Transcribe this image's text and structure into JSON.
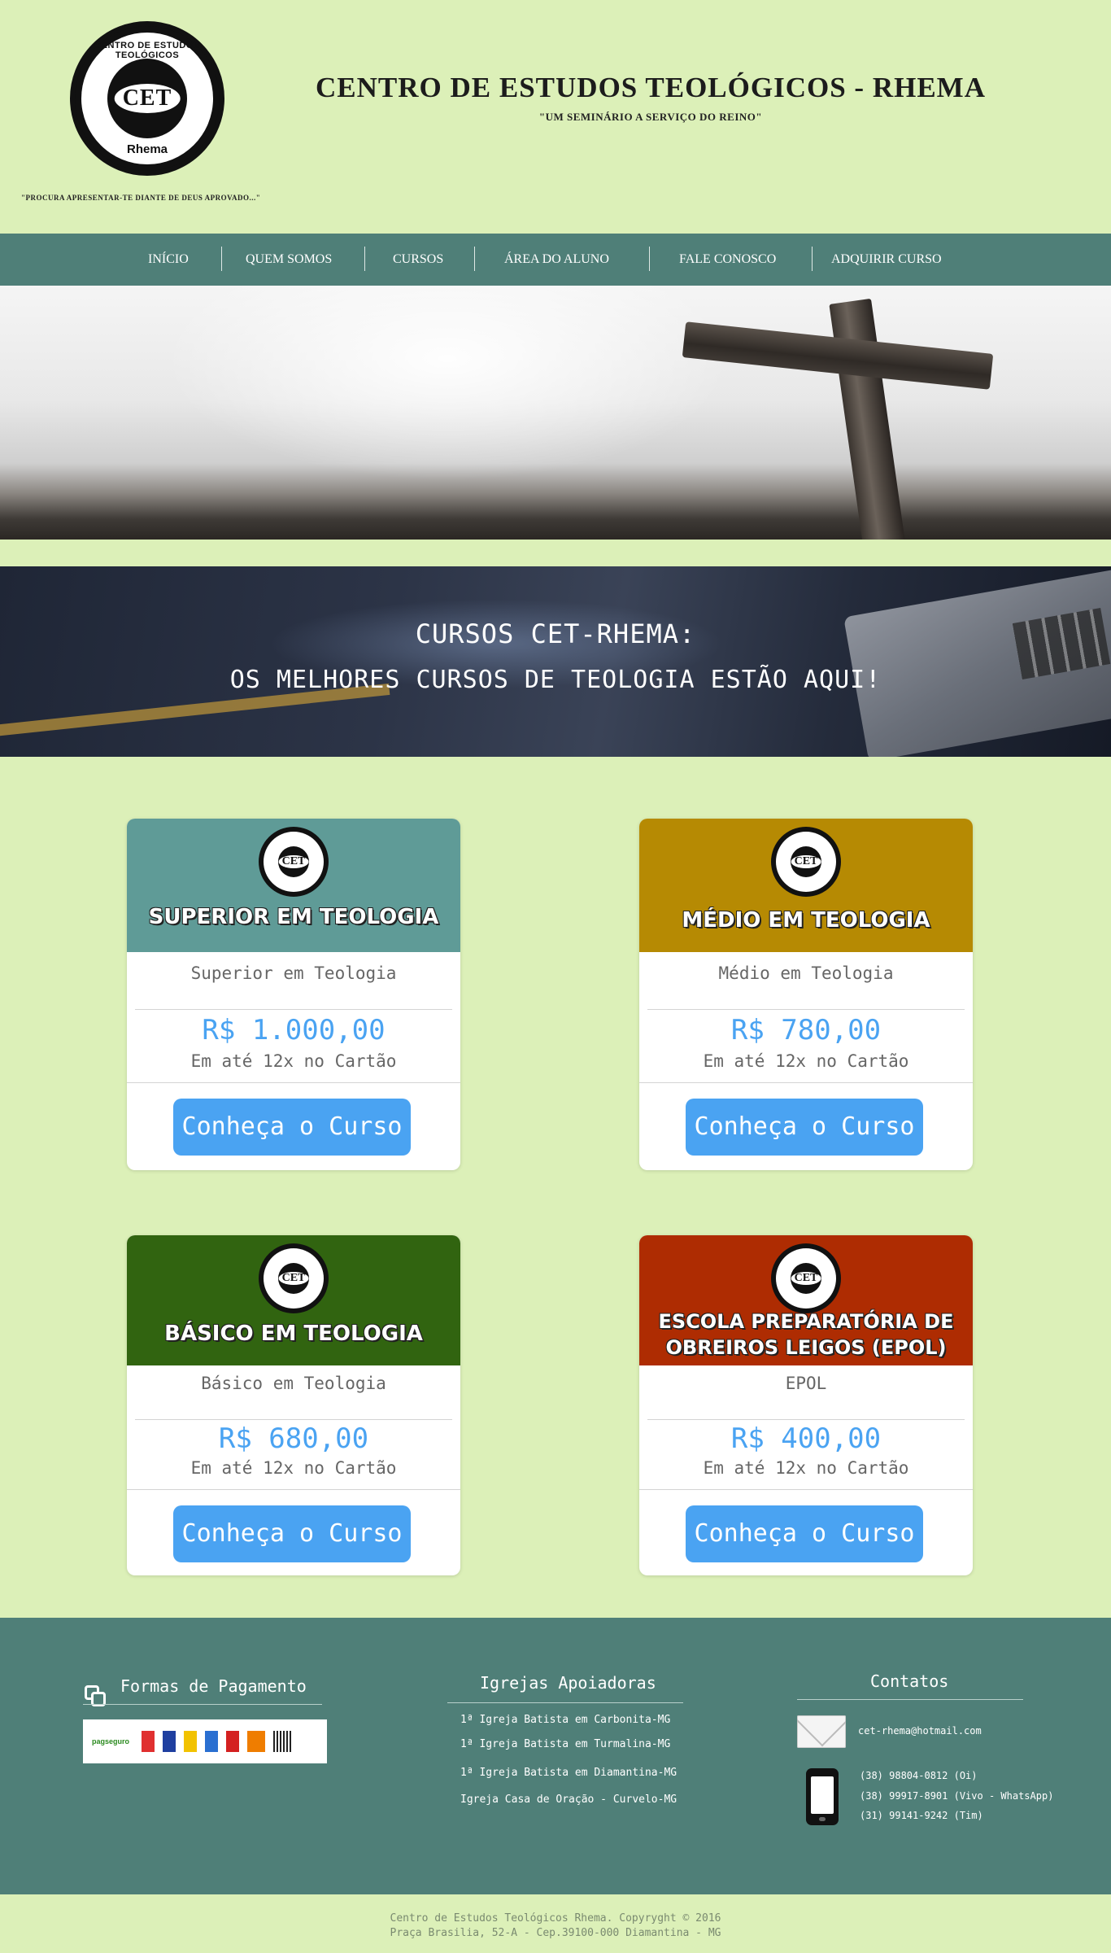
{
  "header": {
    "logo": {
      "ring_top": "CENTRO DE ESTUDOS TEOLÓGICOS",
      "ring_bottom": "Rhema",
      "monogram": "CET"
    },
    "title": "CENTRO DE ESTUDOS TEOLÓGICOS - RHEMA",
    "subtitle": "\"UM SEMINÁRIO A SERVIÇO DO REINO\"",
    "quote": "\"PROCURA APRESENTAR-TE DIANTE DE DEUS APROVADO...\""
  },
  "nav": {
    "items": [
      {
        "label": "INÍCIO"
      },
      {
        "label": "QUEM SOMOS"
      },
      {
        "label": "CURSOS"
      },
      {
        "label": "ÁREA DO ALUNO"
      },
      {
        "label": "FALE CONOSCO"
      },
      {
        "label": "ADQUIRIR CURSO"
      }
    ]
  },
  "banner": {
    "title": "CURSOS CET-RHEMA:",
    "subtitle": "OS MELHORES CURSOS DE TEOLOGIA ESTÃO AQUI!"
  },
  "courses": [
    {
      "head_lines": [
        "SUPERIOR EM TEOLOGIA"
      ],
      "name": "Superior em Teologia",
      "price": "R$ 1.000,00",
      "installments": "Em até 12x no Cartão",
      "button": "Conheça o Curso",
      "color": "#5f9b97"
    },
    {
      "head_lines": [
        "MÉDIO EM TEOLOGIA"
      ],
      "name": "Médio em Teologia",
      "price": "R$ 780,00",
      "installments": "Em até 12x no Cartão",
      "button": "Conheça o Curso",
      "color": "#b68a03"
    },
    {
      "head_lines": [
        "BÁSICO EM TEOLOGIA"
      ],
      "name": "Básico em Teologia",
      "price": "R$ 680,00",
      "installments": "Em até 12x no Cartão",
      "button": "Conheça o Curso",
      "color": "#316410"
    },
    {
      "head_lines": [
        "ESCOLA PREPARATÓRIA DE",
        "OBREIROS LEIGOS (EPOL)"
      ],
      "name": "EPOL",
      "price": "R$ 400,00",
      "installments": "Em até 12x no Cartão",
      "button": "Conheça o Curso",
      "color": "#ae2c02"
    }
  ],
  "footer": {
    "payment": {
      "title": "Formas de Pagamento",
      "logos": [
        "pagseguro",
        "visa",
        "mastercard",
        "banco do brasil",
        "bradesco",
        "hsbc",
        "itau",
        "boleto"
      ]
    },
    "churches": {
      "title": "Igrejas Apoiadoras",
      "items": [
        "1ª Igreja Batista em Carbonita-MG",
        "1ª Igreja Batista em Turmalina-MG",
        "1ª Igreja Batista em Diamantina-MG",
        "Igreja Casa de Oração - Curvelo-MG"
      ]
    },
    "contacts": {
      "title": "Contatos",
      "email": "cet-rhema@hotmail.com",
      "phones": [
        "(38) 98804-0812 (Oi)",
        "(38) 99917-8901 (Vivo - WhatsApp)",
        "(31) 99141-9242 (Tim)"
      ]
    }
  },
  "copyright": {
    "line1": "Centro de Estudos Teológicos Rhema. Copyryght © 2016",
    "line2": "Praça Brasilia, 52-A - Cep.39100-000 Diamantina - MG"
  },
  "colors": {
    "page_bg": "#dcf0b8",
    "nav_bg": "#4f7f78",
    "price_blue": "#4aa3f2"
  }
}
